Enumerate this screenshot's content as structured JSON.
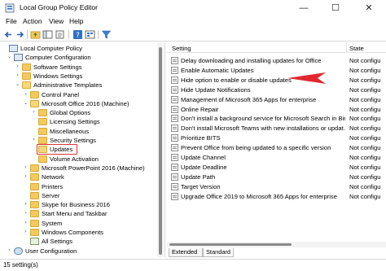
{
  "window": {
    "title": "Local Group Policy Editor",
    "controls": {
      "minimize": "—",
      "maximize": "☐",
      "close": "✕"
    }
  },
  "menu": [
    "File",
    "Action",
    "View",
    "Help"
  ],
  "toolbar": {
    "icons": [
      "back-icon",
      "forward-icon",
      "folder-up-icon",
      "show-hide-tree-icon",
      "properties-icon",
      "export-list-icon",
      "help-icon",
      "view-icon",
      "filter-icon"
    ]
  },
  "tree": {
    "items": [
      {
        "label": "Local Computer Policy",
        "expander": "",
        "icon": "computer-policy-icon",
        "level": 0
      },
      {
        "label": "Computer Configuration",
        "expander": "⌄",
        "icon": "computer-icon",
        "level": 1
      },
      {
        "label": "Software Settings",
        "expander": "›",
        "icon": "folder-icon",
        "level": 2
      },
      {
        "label": "Windows Settings",
        "expander": "›",
        "icon": "folder-icon",
        "level": 2
      },
      {
        "label": "Administrative Templates",
        "expander": "⌄",
        "icon": "folder-open-icon",
        "level": 2
      },
      {
        "label": "Control Panel",
        "expander": "›",
        "icon": "folder-icon",
        "level": 3
      },
      {
        "label": "Microsoft Office 2016 (Machine)",
        "expander": "⌄",
        "icon": "folder-open-icon",
        "level": 3
      },
      {
        "label": "Global Options",
        "expander": "›",
        "icon": "folder-icon",
        "level": 4
      },
      {
        "label": "Licensing Settings",
        "expander": "",
        "icon": "folder-icon",
        "level": 4
      },
      {
        "label": "Miscellaneous",
        "expander": "",
        "icon": "folder-icon",
        "level": 4
      },
      {
        "label": "Security Settings",
        "expander": "›",
        "icon": "folder-icon",
        "level": 4
      },
      {
        "label": "Updates",
        "expander": "",
        "icon": "folder-open-icon",
        "level": 4,
        "selected": true
      },
      {
        "label": "Volume Activation",
        "expander": "",
        "icon": "folder-icon",
        "level": 4
      },
      {
        "label": "Microsoft PowerPoint 2016 (Machine)",
        "expander": "›",
        "icon": "folder-icon",
        "level": 3
      },
      {
        "label": "Network",
        "expander": "›",
        "icon": "folder-icon",
        "level": 3
      },
      {
        "label": "Printers",
        "expander": "",
        "icon": "folder-icon",
        "level": 3
      },
      {
        "label": "Server",
        "expander": "",
        "icon": "folder-icon",
        "level": 3
      },
      {
        "label": "Skype for Business 2016",
        "expander": "›",
        "icon": "folder-icon",
        "level": 3
      },
      {
        "label": "Start Menu and Taskbar",
        "expander": "›",
        "icon": "folder-icon",
        "level": 3
      },
      {
        "label": "System",
        "expander": "›",
        "icon": "folder-icon",
        "level": 3
      },
      {
        "label": "Windows Components",
        "expander": "›",
        "icon": "folder-icon",
        "level": 3
      },
      {
        "label": "All Settings",
        "expander": "",
        "icon": "all-settings-icon",
        "level": 3
      },
      {
        "label": "User Configuration",
        "expander": "›",
        "icon": "user-icon",
        "level": 1
      }
    ]
  },
  "list": {
    "columns": {
      "setting": "Setting",
      "state": "State"
    },
    "rows": [
      {
        "name": "Delay downloading and installing updates for Office",
        "state": "Not configu"
      },
      {
        "name": "Enable Automatic Updates",
        "state": "Not configu"
      },
      {
        "name": "Hide option to enable or disable updates",
        "state": "Not configu"
      },
      {
        "name": "Hide Update Notifications",
        "state": "Not configu"
      },
      {
        "name": "Management of Microsoft 365 Apps for enterprise",
        "state": "Not configu"
      },
      {
        "name": "Online Repair",
        "state": "Not configu"
      },
      {
        "name": "Don't install a background service for Microsoft Search in Bing",
        "state": "Not configu"
      },
      {
        "name": "Don't install Microsoft Teams with new installations or updat…",
        "state": "Not configu"
      },
      {
        "name": "Prioritize BITS",
        "state": "Not configu"
      },
      {
        "name": "Prevent Office from being updated to a specific version",
        "state": "Not configu"
      },
      {
        "name": "Update Channel",
        "state": "Not configu"
      },
      {
        "name": "Update Deadline",
        "state": "Not configu"
      },
      {
        "name": "Update Path",
        "state": "Not configu"
      },
      {
        "name": "Target Version",
        "state": "Not configu"
      },
      {
        "name": "Upgrade Office 2019 to Microsoft 365 Apps for enterprise",
        "state": "Not configu"
      }
    ]
  },
  "tabs": [
    "Extended",
    "Standard"
  ],
  "status": "15 setting(s)",
  "colors": {
    "annotation_arrow": "#e0282e",
    "selection_outline": "#d93838",
    "folder": "#f4c95d"
  }
}
